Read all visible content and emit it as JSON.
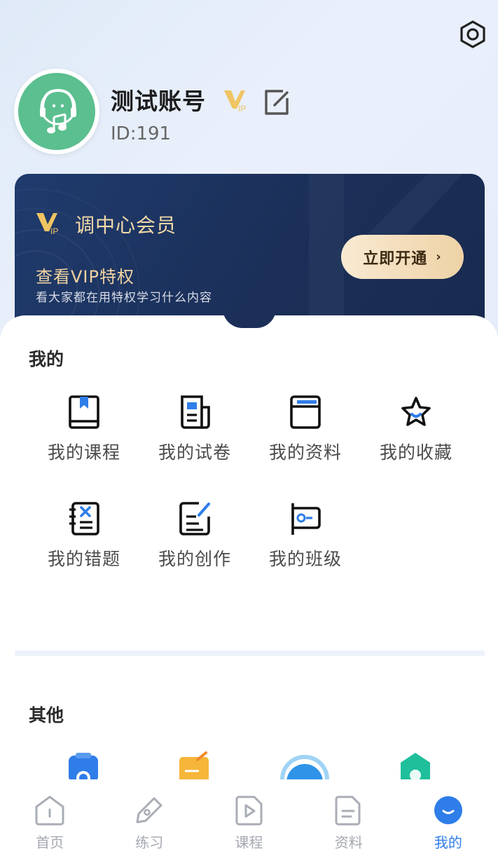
{
  "profile": {
    "username": "测试账号",
    "id_text": "ID:191",
    "vip_badge_text": "VIP"
  },
  "vip_card": {
    "logo_text": "VIP",
    "title": "调中心会员",
    "subtitle": "查看VIP特权",
    "description": "看大家都在用特权学习什么内容",
    "button_label": "立即开通",
    "button_chevron": "›"
  },
  "my_section": {
    "title": "我的",
    "items": [
      {
        "label": "我的课程",
        "icon": "book-icon"
      },
      {
        "label": "我的试卷",
        "icon": "paper-icon"
      },
      {
        "label": "我的资料",
        "icon": "folder-icon"
      },
      {
        "label": "我的收藏",
        "icon": "star-icon"
      },
      {
        "label": "我的错题",
        "icon": "wrong-questions-icon"
      },
      {
        "label": "我的创作",
        "icon": "create-icon"
      },
      {
        "label": "我的班级",
        "icon": "class-flag-icon"
      }
    ]
  },
  "other_section": {
    "title": "其他"
  },
  "tabbar": {
    "tabs": [
      {
        "label": "首页",
        "icon": "home-icon",
        "active": false
      },
      {
        "label": "练习",
        "icon": "pen-icon",
        "active": false
      },
      {
        "label": "课程",
        "icon": "play-icon",
        "active": false
      },
      {
        "label": "资料",
        "icon": "document-icon",
        "active": false
      },
      {
        "label": "我的",
        "icon": "profile-smile-icon",
        "active": true
      }
    ]
  },
  "colors": {
    "accent": "#2f7de8",
    "vip_gold": "#f3d9a8",
    "card_navy": "#1b2f58",
    "avatar_green": "#5bbf8f"
  }
}
